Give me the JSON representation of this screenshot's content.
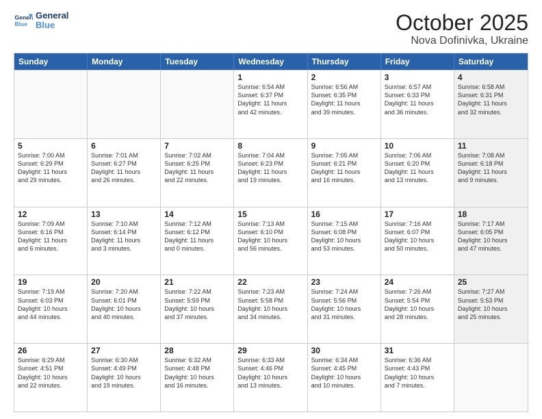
{
  "logo": {
    "line1": "General",
    "line2": "Blue"
  },
  "title": "October 2025",
  "location": "Nova Dofinivka, Ukraine",
  "header_days": [
    "Sunday",
    "Monday",
    "Tuesday",
    "Wednesday",
    "Thursday",
    "Friday",
    "Saturday"
  ],
  "rows": [
    [
      {
        "day": "",
        "info": "",
        "empty": true
      },
      {
        "day": "",
        "info": "",
        "empty": true
      },
      {
        "day": "",
        "info": "",
        "empty": true
      },
      {
        "day": "1",
        "info": "Sunrise: 6:54 AM\nSunset: 6:37 PM\nDaylight: 11 hours\nand 42 minutes."
      },
      {
        "day": "2",
        "info": "Sunrise: 6:56 AM\nSunset: 6:35 PM\nDaylight: 11 hours\nand 39 minutes."
      },
      {
        "day": "3",
        "info": "Sunrise: 6:57 AM\nSunset: 6:33 PM\nDaylight: 11 hours\nand 36 minutes."
      },
      {
        "day": "4",
        "info": "Sunrise: 6:58 AM\nSunset: 6:31 PM\nDaylight: 11 hours\nand 32 minutes.",
        "shaded": true
      }
    ],
    [
      {
        "day": "5",
        "info": "Sunrise: 7:00 AM\nSunset: 6:29 PM\nDaylight: 11 hours\nand 29 minutes."
      },
      {
        "day": "6",
        "info": "Sunrise: 7:01 AM\nSunset: 6:27 PM\nDaylight: 11 hours\nand 26 minutes."
      },
      {
        "day": "7",
        "info": "Sunrise: 7:02 AM\nSunset: 6:25 PM\nDaylight: 11 hours\nand 22 minutes."
      },
      {
        "day": "8",
        "info": "Sunrise: 7:04 AM\nSunset: 6:23 PM\nDaylight: 11 hours\nand 19 minutes."
      },
      {
        "day": "9",
        "info": "Sunrise: 7:05 AM\nSunset: 6:21 PM\nDaylight: 11 hours\nand 16 minutes."
      },
      {
        "day": "10",
        "info": "Sunrise: 7:06 AM\nSunset: 6:20 PM\nDaylight: 11 hours\nand 13 minutes."
      },
      {
        "day": "11",
        "info": "Sunrise: 7:08 AM\nSunset: 6:18 PM\nDaylight: 11 hours\nand 9 minutes.",
        "shaded": true
      }
    ],
    [
      {
        "day": "12",
        "info": "Sunrise: 7:09 AM\nSunset: 6:16 PM\nDaylight: 11 hours\nand 6 minutes."
      },
      {
        "day": "13",
        "info": "Sunrise: 7:10 AM\nSunset: 6:14 PM\nDaylight: 11 hours\nand 3 minutes."
      },
      {
        "day": "14",
        "info": "Sunrise: 7:12 AM\nSunset: 6:12 PM\nDaylight: 11 hours\nand 0 minutes."
      },
      {
        "day": "15",
        "info": "Sunrise: 7:13 AM\nSunset: 6:10 PM\nDaylight: 10 hours\nand 56 minutes."
      },
      {
        "day": "16",
        "info": "Sunrise: 7:15 AM\nSunset: 6:08 PM\nDaylight: 10 hours\nand 53 minutes."
      },
      {
        "day": "17",
        "info": "Sunrise: 7:16 AM\nSunset: 6:07 PM\nDaylight: 10 hours\nand 50 minutes."
      },
      {
        "day": "18",
        "info": "Sunrise: 7:17 AM\nSunset: 6:05 PM\nDaylight: 10 hours\nand 47 minutes.",
        "shaded": true
      }
    ],
    [
      {
        "day": "19",
        "info": "Sunrise: 7:19 AM\nSunset: 6:03 PM\nDaylight: 10 hours\nand 44 minutes."
      },
      {
        "day": "20",
        "info": "Sunrise: 7:20 AM\nSunset: 6:01 PM\nDaylight: 10 hours\nand 40 minutes."
      },
      {
        "day": "21",
        "info": "Sunrise: 7:22 AM\nSunset: 5:59 PM\nDaylight: 10 hours\nand 37 minutes."
      },
      {
        "day": "22",
        "info": "Sunrise: 7:23 AM\nSunset: 5:58 PM\nDaylight: 10 hours\nand 34 minutes."
      },
      {
        "day": "23",
        "info": "Sunrise: 7:24 AM\nSunset: 5:56 PM\nDaylight: 10 hours\nand 31 minutes."
      },
      {
        "day": "24",
        "info": "Sunrise: 7:26 AM\nSunset: 5:54 PM\nDaylight: 10 hours\nand 28 minutes."
      },
      {
        "day": "25",
        "info": "Sunrise: 7:27 AM\nSunset: 5:53 PM\nDaylight: 10 hours\nand 25 minutes.",
        "shaded": true
      }
    ],
    [
      {
        "day": "26",
        "info": "Sunrise: 6:29 AM\nSunset: 4:51 PM\nDaylight: 10 hours\nand 22 minutes."
      },
      {
        "day": "27",
        "info": "Sunrise: 6:30 AM\nSunset: 4:49 PM\nDaylight: 10 hours\nand 19 minutes."
      },
      {
        "day": "28",
        "info": "Sunrise: 6:32 AM\nSunset: 4:48 PM\nDaylight: 10 hours\nand 16 minutes."
      },
      {
        "day": "29",
        "info": "Sunrise: 6:33 AM\nSunset: 4:46 PM\nDaylight: 10 hours\nand 13 minutes."
      },
      {
        "day": "30",
        "info": "Sunrise: 6:34 AM\nSunset: 4:45 PM\nDaylight: 10 hours\nand 10 minutes."
      },
      {
        "day": "31",
        "info": "Sunrise: 6:36 AM\nSunset: 4:43 PM\nDaylight: 10 hours\nand 7 minutes."
      },
      {
        "day": "",
        "info": "",
        "empty": true,
        "shaded": true
      }
    ]
  ]
}
